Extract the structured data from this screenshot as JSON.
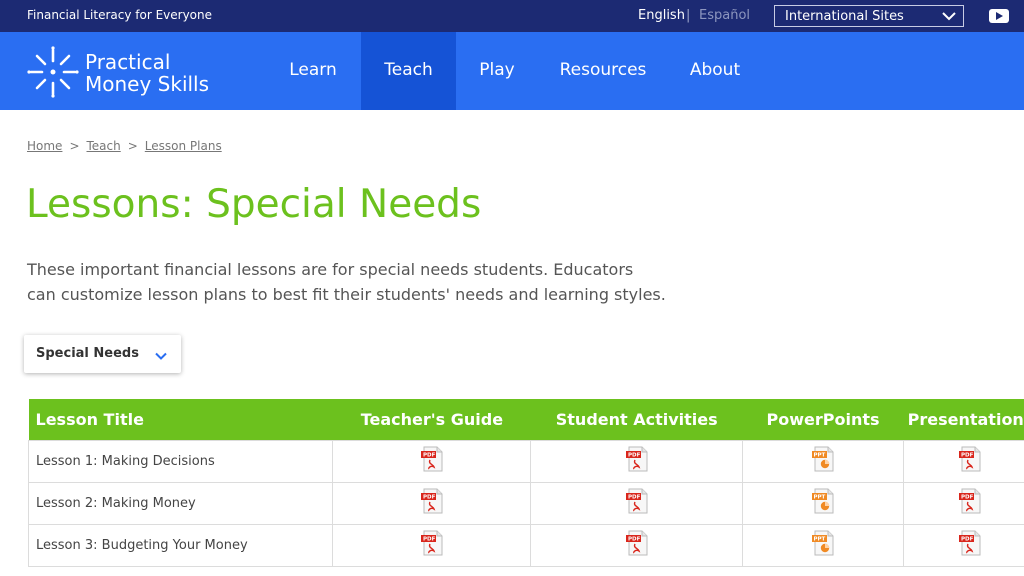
{
  "topbar": {
    "tagline": "Financial Literacy for Everyone",
    "lang_english": "English",
    "lang_separator": "|",
    "lang_spanish": "Español",
    "intl_sites": "International Sites",
    "youtube_icon": "youtube-icon"
  },
  "brand": {
    "line1": "Practical",
    "line2": "Money Skills",
    "logo_icon": "sunburst-logo-icon"
  },
  "nav": {
    "items": [
      {
        "label": "Learn",
        "active": false
      },
      {
        "label": "Teach",
        "active": true
      },
      {
        "label": "Play",
        "active": false
      },
      {
        "label": "Resources",
        "active": false
      },
      {
        "label": "About",
        "active": false
      }
    ]
  },
  "breadcrumb": {
    "items": [
      "Home",
      "Teach",
      "Lesson Plans"
    ],
    "separator": ">"
  },
  "page": {
    "title": "Lessons: Special Needs",
    "intro": "These important financial lessons are for special needs students. Educators can customize lesson plans to best fit their students' needs and learning styles."
  },
  "filter": {
    "selected": "Special Needs"
  },
  "table": {
    "headers": [
      "Lesson Title",
      "Teacher's Guide",
      "Student Activities",
      "PowerPoints",
      "Presentations"
    ],
    "rows": [
      {
        "title": "Lesson 1: Making Decisions",
        "files": [
          "pdf",
          "pdf",
          "ppt",
          "pdf"
        ]
      },
      {
        "title": "Lesson 2: Making Money",
        "files": [
          "pdf",
          "pdf",
          "ppt",
          "pdf"
        ]
      },
      {
        "title": "Lesson 3: Budgeting Your Money",
        "files": [
          "pdf",
          "pdf",
          "ppt",
          "pdf"
        ]
      }
    ]
  },
  "colors": {
    "topbar_bg": "#1c2a73",
    "nav_bg": "#2a6ef2",
    "nav_active_bg": "#1553d6",
    "accent_green": "#6cc11e",
    "pdf_red": "#d9261c",
    "ppt_orange": "#f08a24"
  }
}
